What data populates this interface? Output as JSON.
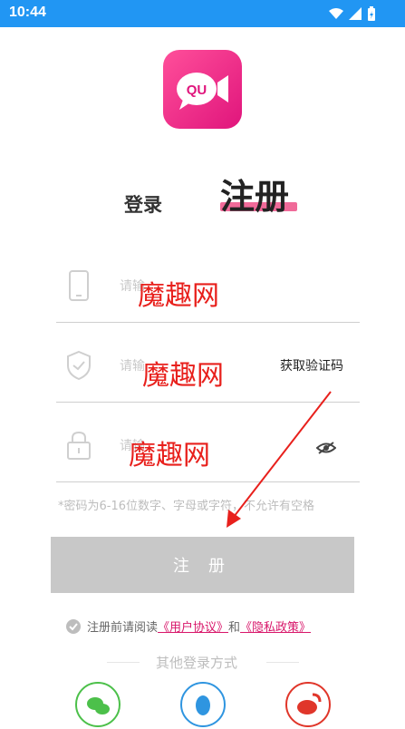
{
  "status_bar": {
    "time": "10:44"
  },
  "app": {
    "logo_text": "QU"
  },
  "tabs": {
    "login": "登录",
    "register": "注册"
  },
  "form": {
    "phone_placeholder": "请输",
    "code_placeholder": "请输",
    "password_placeholder": "请输",
    "get_code": "获取验证码",
    "watermark": "魔趣网",
    "hint": "*密码为6-16位数字、字母或字符，不允许有空格"
  },
  "submit_button": "注 册",
  "agreement": {
    "prefix": "注册前请阅读",
    "user_agreement": "《用户协议》",
    "and": "和",
    "privacy_policy": "《隐私政策》"
  },
  "other_login": {
    "label": "其他登录方式"
  },
  "colors": {
    "status_bar": "#2196f3",
    "brand_pink": "#e0157c",
    "button_disabled": "#c8c8c8",
    "arrow_red": "#e8201c"
  }
}
